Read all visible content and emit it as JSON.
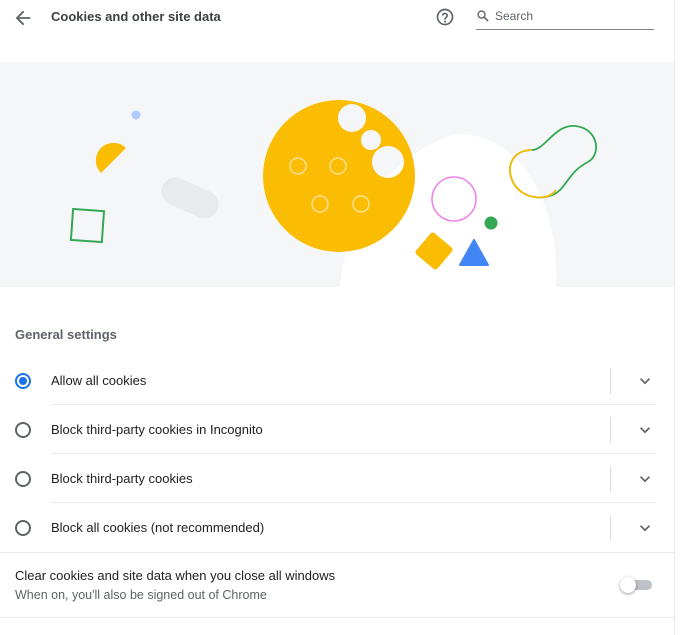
{
  "header": {
    "title": "Cookies and other site data",
    "back_icon": "arrow-back-icon",
    "help_icon": "help-icon",
    "search": {
      "placeholder": "Search",
      "value": ""
    }
  },
  "colors": {
    "accent": "#1a73e8",
    "cookie": "#fbbc04",
    "green": "#34a853",
    "blue": "#4285f4",
    "pink": "#ee82ee",
    "banner_bg": "#f5f6f8"
  },
  "general_settings": {
    "title": "General settings",
    "options": [
      {
        "label": "Allow all cookies",
        "selected": true
      },
      {
        "label": "Block third-party cookies in Incognito",
        "selected": false
      },
      {
        "label": "Block third-party cookies",
        "selected": false
      },
      {
        "label": "Block all cookies (not recommended)",
        "selected": false
      }
    ]
  },
  "clear_on_exit": {
    "title": "Clear cookies and site data when you close all windows",
    "subtitle": "When on, you'll also be signed out of Chrome",
    "enabled": false
  }
}
